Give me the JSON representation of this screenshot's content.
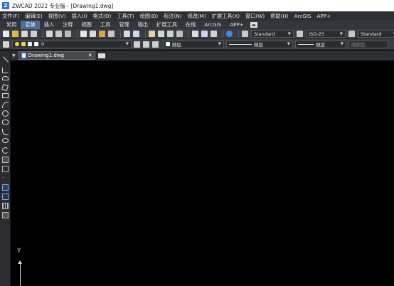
{
  "window": {
    "title": "ZWCAD 2022 专业版 - [Drawing1.dwg]",
    "app_icon": "Z"
  },
  "menu": [
    "文件(F)",
    "编辑(E)",
    "视图(V)",
    "插入(I)",
    "格式(O)",
    "工具(T)",
    "绘图(D)",
    "标注(N)",
    "修改(M)",
    "扩展工具(X)",
    "窗口(W)",
    "帮助(H)",
    "ArcGIS",
    "APP+"
  ],
  "ribbon_tabs": {
    "items": [
      "常用",
      "实体",
      "插入",
      "注释",
      "视图",
      "工具",
      "管理",
      "输出",
      "扩展工具",
      "在线",
      "ArcGIS",
      "APP+"
    ],
    "active_index": 1
  },
  "styles": {
    "text_style": "Standard",
    "dim_style": "ISO-25",
    "table_style": "Standard"
  },
  "layer_bar": {
    "layer_value": "0",
    "color": "随层",
    "linetype": "随层",
    "lineweight": "随层",
    "plotstyle": "随颜色"
  },
  "documents": [
    {
      "name": "Drawing1.dwg",
      "close": "✕"
    }
  ],
  "ucs": {
    "y_label": "Y"
  },
  "colors": {
    "accent": "#4a6e9a",
    "canvas": "#000000"
  }
}
